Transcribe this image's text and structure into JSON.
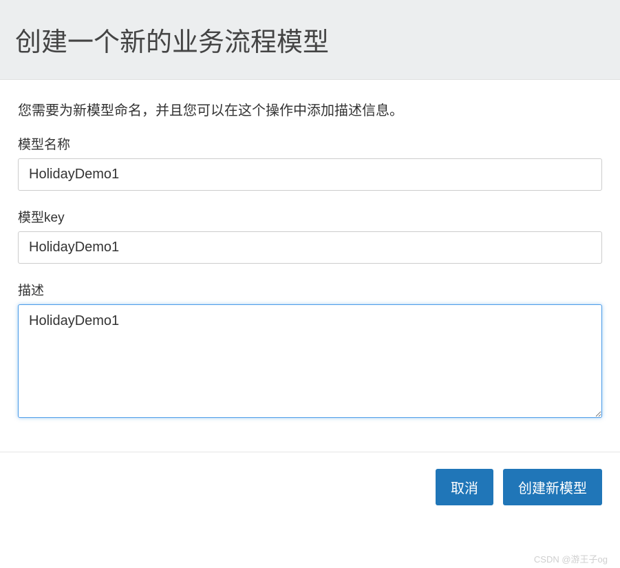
{
  "header": {
    "title": "创建一个新的业务流程模型"
  },
  "body": {
    "intro": "您需要为新模型命名，并且您可以在这个操作中添加描述信息。",
    "fields": {
      "name": {
        "label": "模型名称",
        "value": "HolidayDemo1"
      },
      "key": {
        "label": "模型key",
        "value": "HolidayDemo1"
      },
      "description": {
        "label": "描述",
        "value": "HolidayDemo1"
      }
    }
  },
  "footer": {
    "cancel_label": "取消",
    "submit_label": "创建新模型"
  },
  "watermark": "CSDN @游王子og"
}
